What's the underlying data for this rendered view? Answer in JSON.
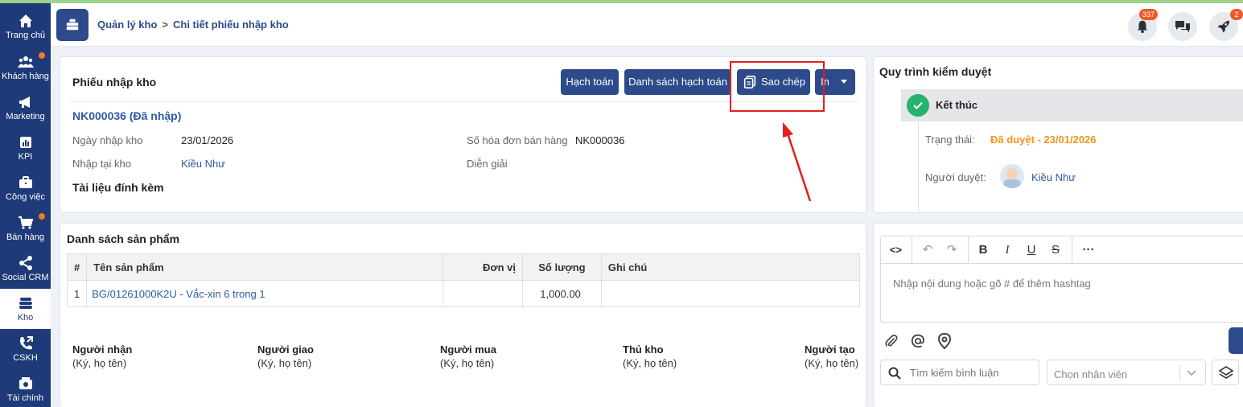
{
  "sidebar": {
    "items": [
      {
        "label": "Trang chủ",
        "icon": "home-icon"
      },
      {
        "label": "Khách hàng",
        "icon": "users-icon"
      },
      {
        "label": "Marketing",
        "icon": "megaphone-icon"
      },
      {
        "label": "KPI",
        "icon": "chart-icon"
      },
      {
        "label": "Công việc",
        "icon": "briefcase-icon"
      },
      {
        "label": "Bán hàng",
        "icon": "cart-icon"
      },
      {
        "label": "Social CRM",
        "icon": "share-icon"
      },
      {
        "label": "Kho",
        "icon": "warehouse-icon"
      },
      {
        "label": "CSKH",
        "icon": "phone-icon"
      },
      {
        "label": "Tài chính",
        "icon": "wallet-icon"
      }
    ]
  },
  "header": {
    "crumb1": "Quản lý kho",
    "crumb_sep": ">",
    "crumb2": "Chi tiết phiếu nhập kho",
    "notif_count": "337",
    "rocket_count": "2"
  },
  "receipt": {
    "title": "Phiếu nhập kho",
    "buttons": {
      "accounting": "Hạch toán",
      "accounting_list": "Danh sách hạch toán",
      "copy": "Sao chép",
      "print": "In"
    },
    "code": "NK000036 (Đã nhập)",
    "date_label": "Ngày nhập kho",
    "date_value": "23/01/2026",
    "invoice_label": "Số hóa đơn bán hàng",
    "invoice_value": "NK000036",
    "warehouse_label": "Nhập tại kho",
    "warehouse_value": "Kiều Như",
    "desc_label": "Diễn giải",
    "attachments": "Tài liệu đính kèm"
  },
  "products": {
    "title": "Danh sách sản phẩm",
    "headers": [
      "#",
      "Tên sản phẩm",
      "Đơn vị",
      "Số lượng",
      "Ghi chú"
    ],
    "rows": [
      {
        "no": "1",
        "name": "BG/01261000K2U - Vắc-xin 6 trong 1",
        "unit": "",
        "qty": "1,000.00",
        "note": ""
      }
    ]
  },
  "signatures": [
    {
      "role": "Người nhận",
      "hint": "(Ký, họ tên)"
    },
    {
      "role": "Người giao",
      "hint": "(Ký, họ tên)"
    },
    {
      "role": "Người mua",
      "hint": "(Ký, họ tên)"
    },
    {
      "role": "Thủ kho",
      "hint": "(Ký, họ tên)"
    },
    {
      "role": "Người tạo",
      "hint": "(Ký, họ tên)"
    }
  ],
  "approval": {
    "title": "Quy trình kiểm duyệt",
    "step": "Kết thúc",
    "status_label": "Trạng thái:",
    "status_value": "Đã duyệt - 23/01/2026",
    "approver_label": "Người duyệt:",
    "approver_name": "Kiều Như",
    "status_color": "#f0931a"
  },
  "comments": {
    "placeholder": "Nhập nội dung hoặc gõ # để thêm hashtag",
    "search_placeholder": "Tìm kiếm bình luận",
    "employee_placeholder": "Chọn nhân viên"
  },
  "colors": {
    "primary": "#2d4a8a",
    "sidebar": "#1e3a78",
    "highlight": "#e61e1e"
  }
}
